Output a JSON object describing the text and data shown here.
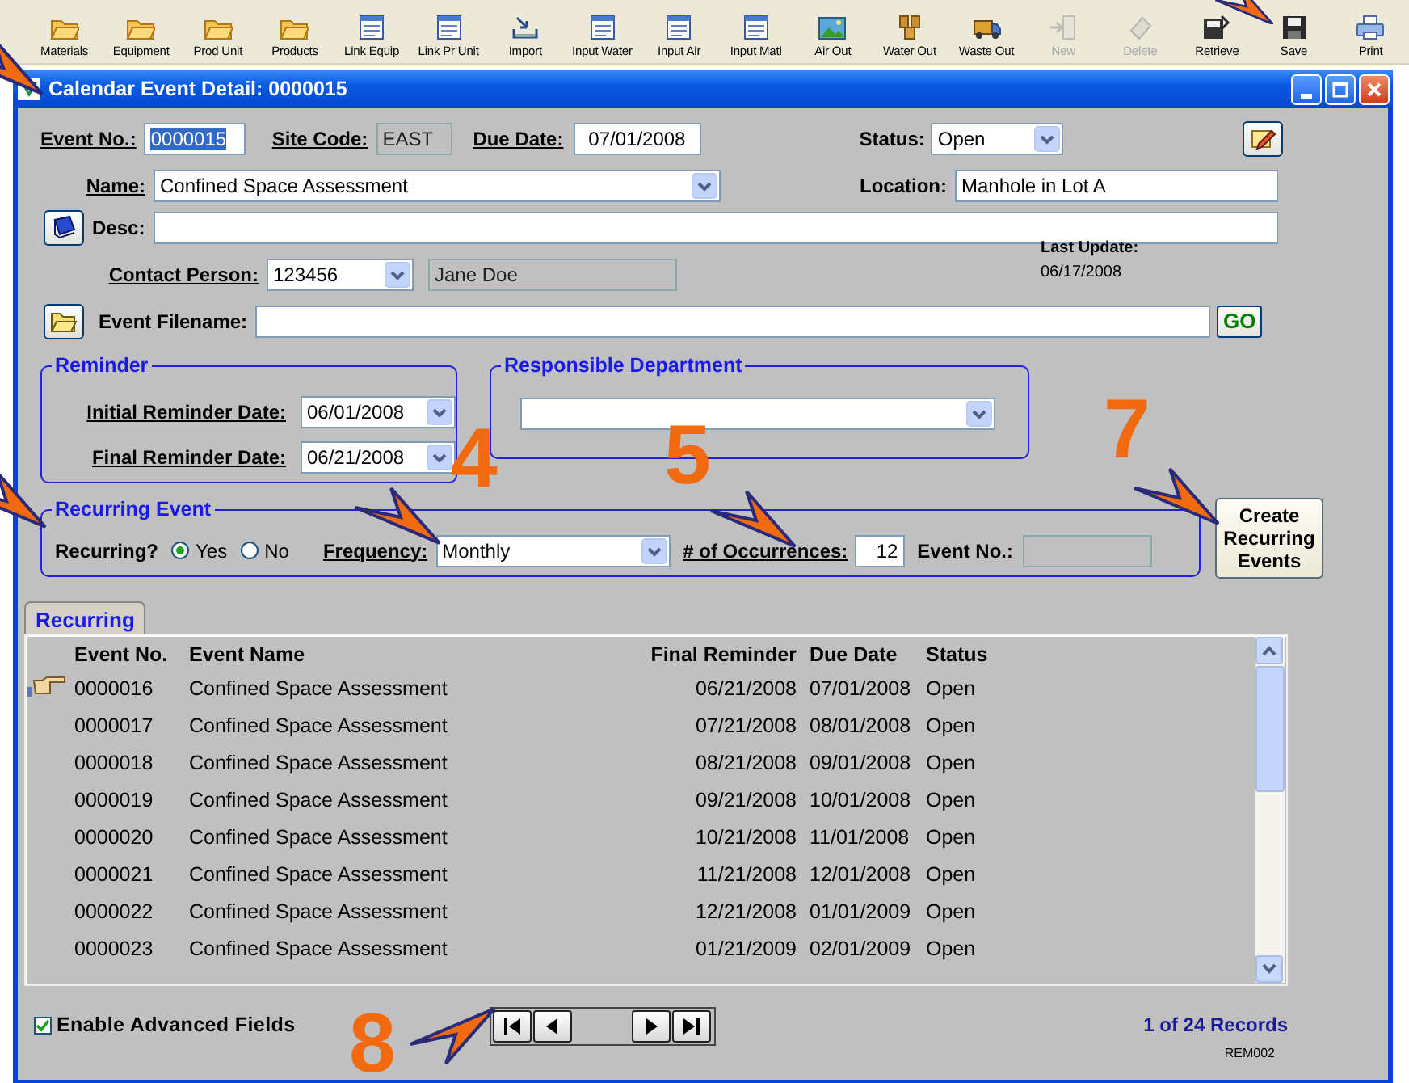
{
  "toolbar": [
    {
      "label": "Materials",
      "kind": "folder",
      "disabled": false
    },
    {
      "label": "Equipment",
      "kind": "folder",
      "disabled": false
    },
    {
      "label": "Prod Unit",
      "kind": "folder",
      "disabled": false
    },
    {
      "label": "Products",
      "kind": "folder",
      "disabled": false
    },
    {
      "label": "Link Equip",
      "kind": "form",
      "disabled": false
    },
    {
      "label": "Link Pr Unit",
      "kind": "form",
      "disabled": false
    },
    {
      "label": "Import",
      "kind": "import",
      "disabled": false
    },
    {
      "label": "Input Water",
      "kind": "form",
      "disabled": false
    },
    {
      "label": "Input Air",
      "kind": "form",
      "disabled": false
    },
    {
      "label": "Input Matl",
      "kind": "form",
      "disabled": false
    },
    {
      "label": "Air Out",
      "kind": "image",
      "disabled": false
    },
    {
      "label": "Water Out",
      "kind": "barrel",
      "disabled": false
    },
    {
      "label": "Waste Out",
      "kind": "truck",
      "disabled": false
    },
    {
      "label": "New",
      "kind": "door",
      "disabled": true
    },
    {
      "label": "Delete",
      "kind": "eraser",
      "disabled": true
    },
    {
      "label": "Retrieve",
      "kind": "retrieve",
      "disabled": false
    },
    {
      "label": "Save",
      "kind": "disk",
      "disabled": false
    },
    {
      "label": "Print",
      "kind": "printer",
      "disabled": false
    }
  ],
  "window": {
    "title": "Calendar Event Detail: 0000015"
  },
  "form": {
    "event_no": {
      "label": "Event No.:",
      "underlined": true,
      "value": "0000015",
      "text_selected": true
    },
    "site_code": {
      "label": "Site Code:",
      "underlined": true,
      "value": "EAST"
    },
    "due_date": {
      "label": "Due Date:",
      "underlined": true,
      "value": "07/01/2008"
    },
    "status": {
      "label": "Status:",
      "underlined": false,
      "value": "Open"
    },
    "name": {
      "label": "Name:",
      "underlined": true,
      "value": "Confined Space Assessment"
    },
    "location": {
      "label": "Location:",
      "underlined": false,
      "value": "Manhole in Lot A"
    },
    "desc": {
      "label": "Desc:",
      "underlined": false
    },
    "contact_person": {
      "label": "Contact Person:",
      "underlined": true,
      "value": "123456",
      "person_name": "Jane Doe"
    },
    "last_update": {
      "label": "Last Update:",
      "value": "06/17/2008"
    },
    "event_filename": {
      "label": "Event Filename:",
      "underlined": false,
      "button": "GO"
    }
  },
  "reminder": {
    "title": "Reminder",
    "initial": {
      "label": "Initial Reminder Date:",
      "underlined": true,
      "value": "06/01/2008"
    },
    "final": {
      "label": "Final Reminder Date:",
      "underlined": true,
      "value": "06/21/2008"
    }
  },
  "responsible_department": {
    "title": "Responsible Department"
  },
  "recurring": {
    "title": "Recurring Event",
    "question": "Recurring?",
    "options": [
      {
        "label": "Yes",
        "selected": true
      },
      {
        "label": "No",
        "selected": false
      }
    ],
    "frequency": {
      "label": "Frequency:",
      "underlined": true,
      "value": "Monthly"
    },
    "occurrences": {
      "label": "# of Occurrences:",
      "underlined": true,
      "value": "12"
    },
    "event_no": {
      "label": "Event No.:"
    }
  },
  "create_button": "Create Recurring Events",
  "tabs": [
    {
      "label": "Recurring",
      "selected": true
    }
  ],
  "table": {
    "columns": [
      "Event No.",
      "Event Name",
      "Final Reminder",
      "Due Date",
      "Status"
    ],
    "rows": [
      {
        "cells": [
          "0000016",
          "Confined Space Assessment",
          "06/21/2008",
          "07/01/2008",
          "Open"
        ],
        "current": true
      },
      {
        "cells": [
          "0000017",
          "Confined Space Assessment",
          "07/21/2008",
          "08/01/2008",
          "Open"
        ],
        "current": false
      },
      {
        "cells": [
          "0000018",
          "Confined Space Assessment",
          "08/21/2008",
          "09/01/2008",
          "Open"
        ],
        "current": false
      },
      {
        "cells": [
          "0000019",
          "Confined Space Assessment",
          "09/21/2008",
          "10/01/2008",
          "Open"
        ],
        "current": false
      },
      {
        "cells": [
          "0000020",
          "Confined Space Assessment",
          "10/21/2008",
          "11/01/2008",
          "Open"
        ],
        "current": false
      },
      {
        "cells": [
          "0000021",
          "Confined Space Assessment",
          "11/21/2008",
          "12/01/2008",
          "Open"
        ],
        "current": false
      },
      {
        "cells": [
          "0000022",
          "Confined Space Assessment",
          "12/21/2008",
          "01/01/2009",
          "Open"
        ],
        "current": false
      },
      {
        "cells": [
          "0000023",
          "Confined Space Assessment",
          "01/21/2009",
          "02/01/2009",
          "Open"
        ],
        "current": false
      }
    ]
  },
  "footer": {
    "checkbox": {
      "label": "Enable Advanced Fields",
      "checked": true
    },
    "record_count": "1 of 24 Records",
    "form_code": "REM002"
  },
  "callouts": [
    {
      "number": "4"
    },
    {
      "number": "5"
    },
    {
      "number": "7"
    },
    {
      "number": "8"
    }
  ]
}
